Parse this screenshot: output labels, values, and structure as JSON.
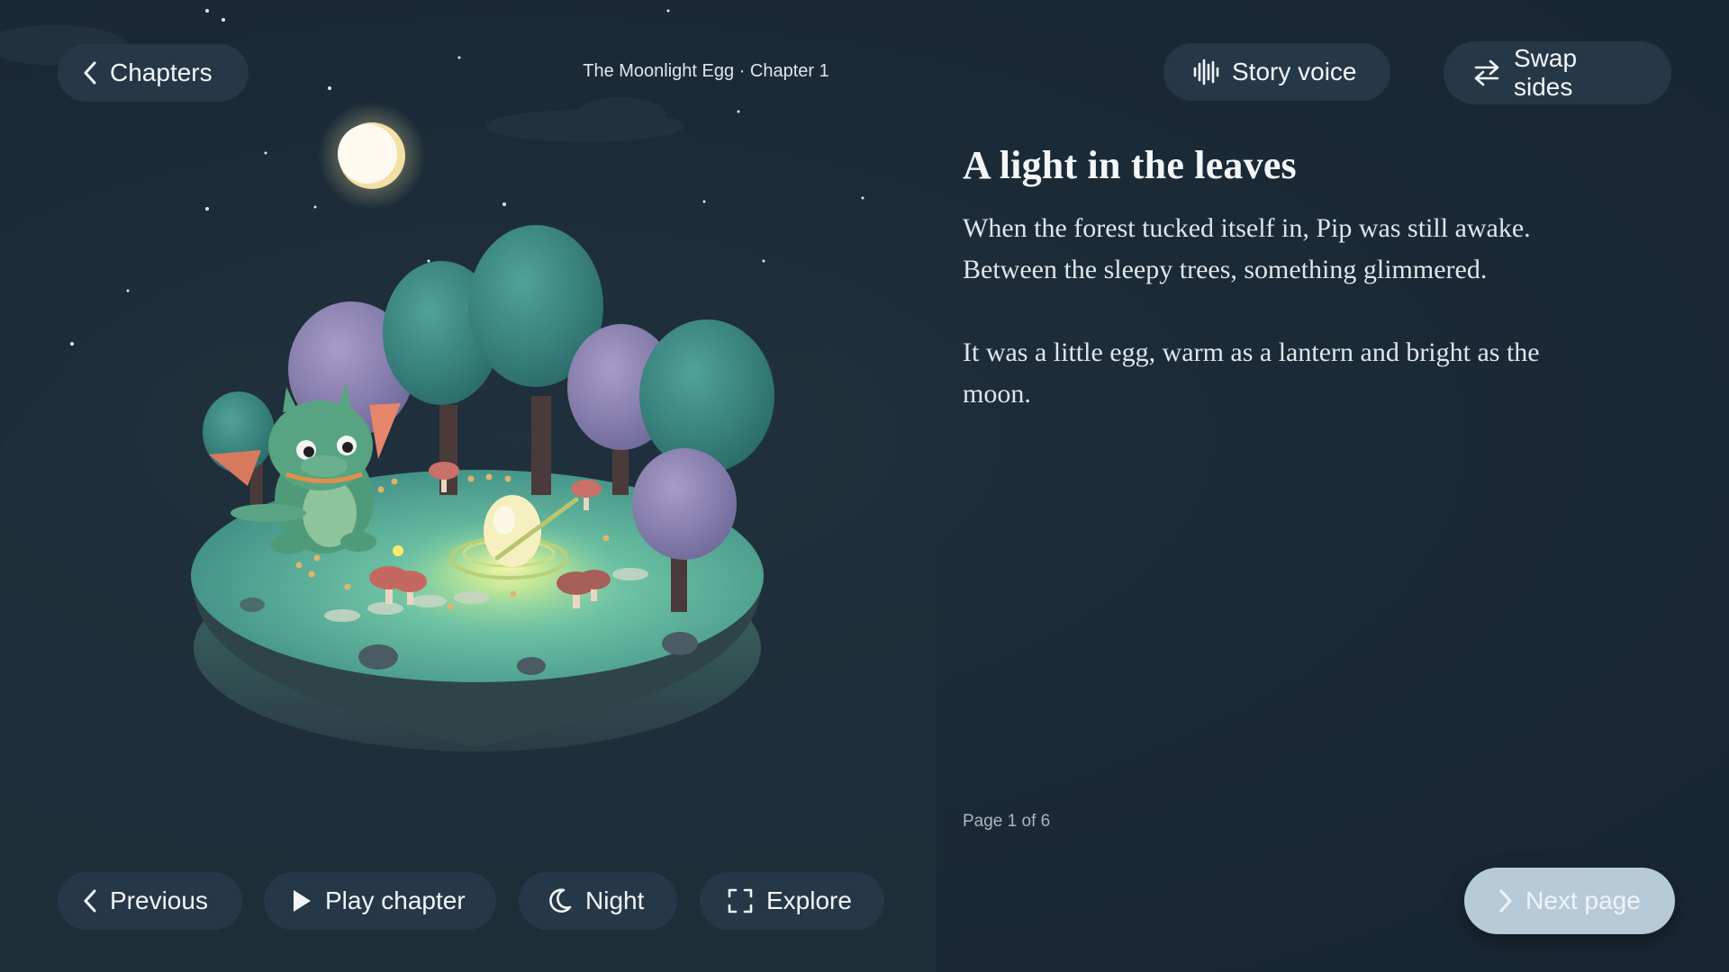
{
  "header": {
    "back_label": "Chapters",
    "book_title": "The Moonlight Egg · Chapter 1",
    "story_voice_label": "Story voice",
    "swap_sides_label": "Swap sides"
  },
  "story": {
    "heading": "A light in the leaves",
    "paragraphs": [
      "When the forest tucked itself in, Pip was still awake. Between the sleepy trees, something glimmered.",
      "It was a little egg, warm as a lantern and bright as the moon."
    ],
    "page_indicator": "Page 1 of 6"
  },
  "footer": {
    "previous_label": "Previous",
    "play_label": "Play chapter",
    "night_label": "Night",
    "explore_label": "Explore",
    "next_label": "Next page"
  },
  "icons": {
    "back": "chevron-left-icon",
    "voice": "waveform-icon",
    "swap": "swap-arrows-icon",
    "previous": "chevron-left-icon",
    "play": "play-icon",
    "night": "moon-icon",
    "explore": "fullscreen-icon",
    "next": "chevron-right-icon"
  },
  "colors": {
    "background": "#1a2a36",
    "button": "#263847",
    "next_button": "#b7cad8",
    "dragon": "#4f9a78",
    "ground": "#5fb39a",
    "egg_glow": "#fff4a8"
  }
}
